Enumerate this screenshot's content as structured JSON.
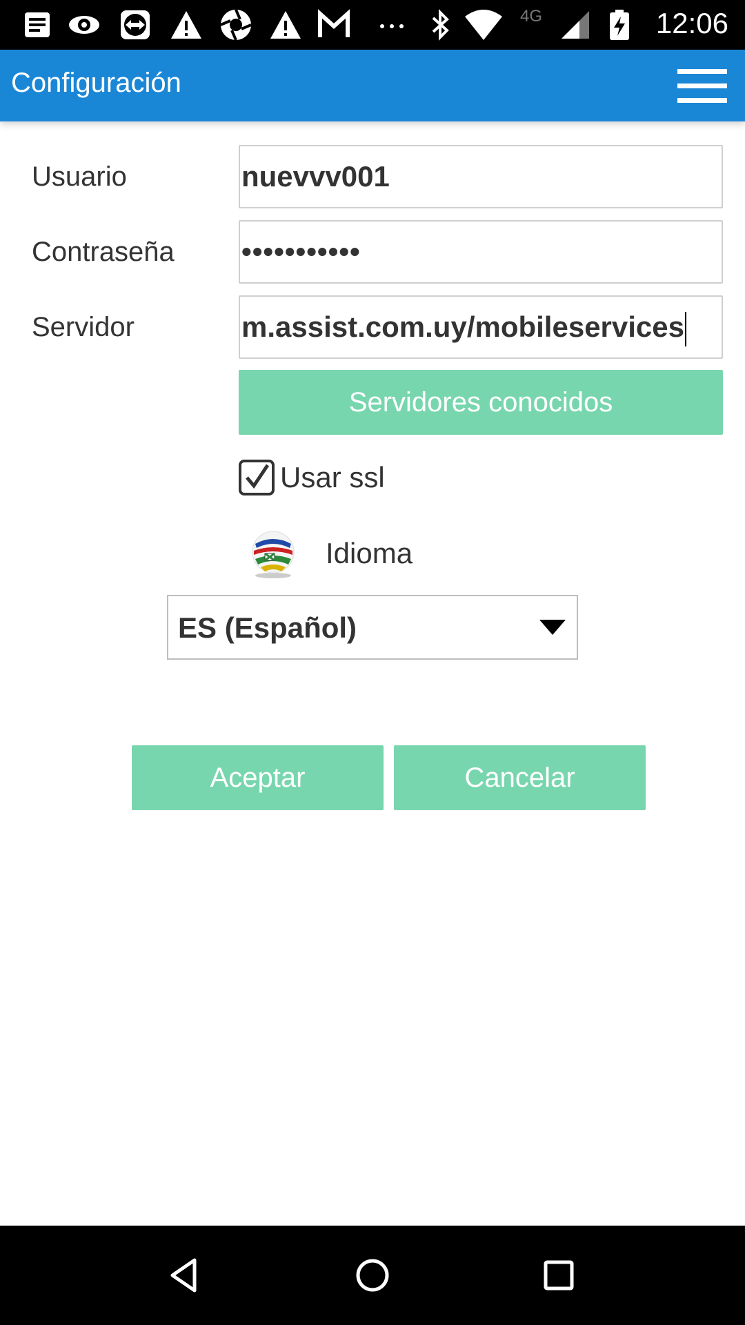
{
  "status_bar": {
    "time": "12:06",
    "network": "4G",
    "icons": [
      "notes-icon",
      "eye-icon",
      "teamviewer-icon",
      "warning-icon",
      "aperture-icon",
      "warning-icon",
      "gmail-icon",
      "more-icon",
      "bluetooth-icon",
      "wifi-icon",
      "signal-icon",
      "battery-charging-icon"
    ]
  },
  "appbar": {
    "title": "Configuración",
    "menu_icon": "hamburger-menu-icon"
  },
  "form": {
    "usuario_label": "Usuario",
    "usuario_value": "nuevvv001",
    "password_label": "Contraseña",
    "password_value": "•••••••••••",
    "servidor_label": "Servidor",
    "servidor_value": "m.assist.com.uy/mobileservices",
    "known_servers_button": "Servidores conocidos",
    "ssl_label": "Usar ssl",
    "ssl_checked": true,
    "language_label": "Idioma",
    "language_icon": "globe-flags-icon",
    "language_selected": "ES (Español)"
  },
  "actions": {
    "accept": "Aceptar",
    "cancel": "Cancelar"
  },
  "colors": {
    "appbar": "#1a87d6",
    "button": "#78d6ae"
  },
  "nav_bar": {
    "icons": [
      "back-icon",
      "home-icon",
      "recents-icon"
    ]
  }
}
